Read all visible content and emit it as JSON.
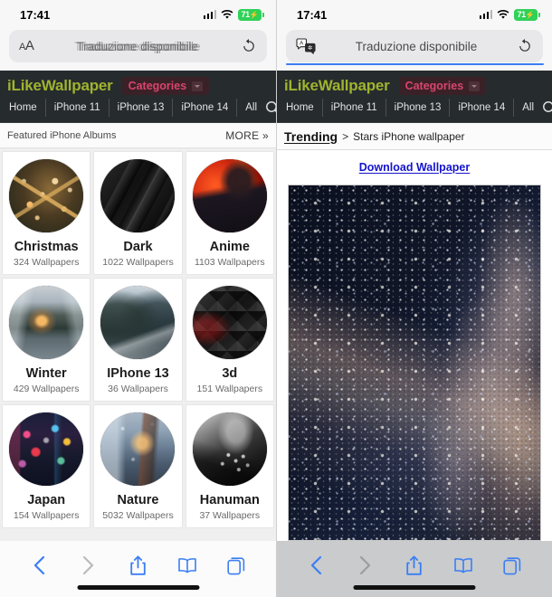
{
  "left": {
    "status": {
      "time": "17:41",
      "battery_percent": "71",
      "battery_charging": true,
      "wifi": "wifi-icon",
      "cellular": "signal-icon"
    },
    "address_bar": {
      "left_control": "AA",
      "left_control_name": "text-size-icon",
      "text": "Traduzione disponibile",
      "ghosted": true,
      "reload_icon": "reload-icon"
    },
    "site": {
      "brand": "iLikeWallpaper",
      "brand_color": "#9fb32f",
      "categories_label": "Categories",
      "categories_color": "#d8456c",
      "nav": [
        "Home",
        "iPhone 11",
        "iPhone 13",
        "iPhone 14",
        "All"
      ],
      "search_icon": "search-icon"
    },
    "featured": {
      "title": "Featured iPhone Albums",
      "more": "MORE »"
    },
    "albums": [
      {
        "name": "Christmas",
        "count": "324 Wallpapers",
        "art": "art-christmas"
      },
      {
        "name": "Dark",
        "count": "1022 Wallpapers",
        "art": "art-dark"
      },
      {
        "name": "Anime",
        "count": "1103 Wallpapers",
        "art": "art-anime"
      },
      {
        "name": "Winter",
        "count": "429 Wallpapers",
        "art": "art-winter"
      },
      {
        "name": "IPhone 13",
        "count": "36 Wallpapers",
        "art": "art-iphone13"
      },
      {
        "name": "3d",
        "count": "151 Wallpapers",
        "art": "art-3d"
      },
      {
        "name": "Japan",
        "count": "154 Wallpapers",
        "art": "art-japan"
      },
      {
        "name": "Nature",
        "count": "5032 Wallpapers",
        "art": "art-nature"
      },
      {
        "name": "Hanuman",
        "count": "37 Wallpapers",
        "art": "art-hanuman"
      }
    ],
    "toolbar": {
      "back": "back-icon",
      "forward": "forward-icon",
      "share": "share-icon",
      "bookmarks": "bookmarks-icon",
      "tabs": "tabs-icon",
      "back_enabled": true,
      "forward_enabled": false
    }
  },
  "right": {
    "status": {
      "time": "17:41",
      "battery_percent": "71",
      "battery_charging": true,
      "wifi": "wifi-icon",
      "cellular": "signal-icon"
    },
    "address_bar": {
      "left_control_name": "translate-icon",
      "text": "Traduzione disponibile",
      "ghosted": false,
      "reload_icon": "reload-icon",
      "progress_color": "#3b7ef3"
    },
    "site": {
      "brand": "iLikeWallpaper",
      "brand_color": "#9fb32f",
      "categories_label": "Categories",
      "categories_color": "#d8456c",
      "nav": [
        "Home",
        "iPhone 11",
        "iPhone 13",
        "iPhone 14",
        "All"
      ],
      "search_icon": "search-icon"
    },
    "breadcrumb": {
      "link": "Trending",
      "separator": ">",
      "current": "Stars iPhone wallpaper"
    },
    "download_link": "Download Wallpaper",
    "wallpaper_alt": "Stars iPhone wallpaper",
    "toolbar": {
      "back": "back-icon",
      "forward": "forward-icon",
      "share": "share-icon",
      "bookmarks": "bookmarks-icon",
      "tabs": "tabs-icon",
      "back_enabled": true,
      "forward_enabled": false
    }
  }
}
